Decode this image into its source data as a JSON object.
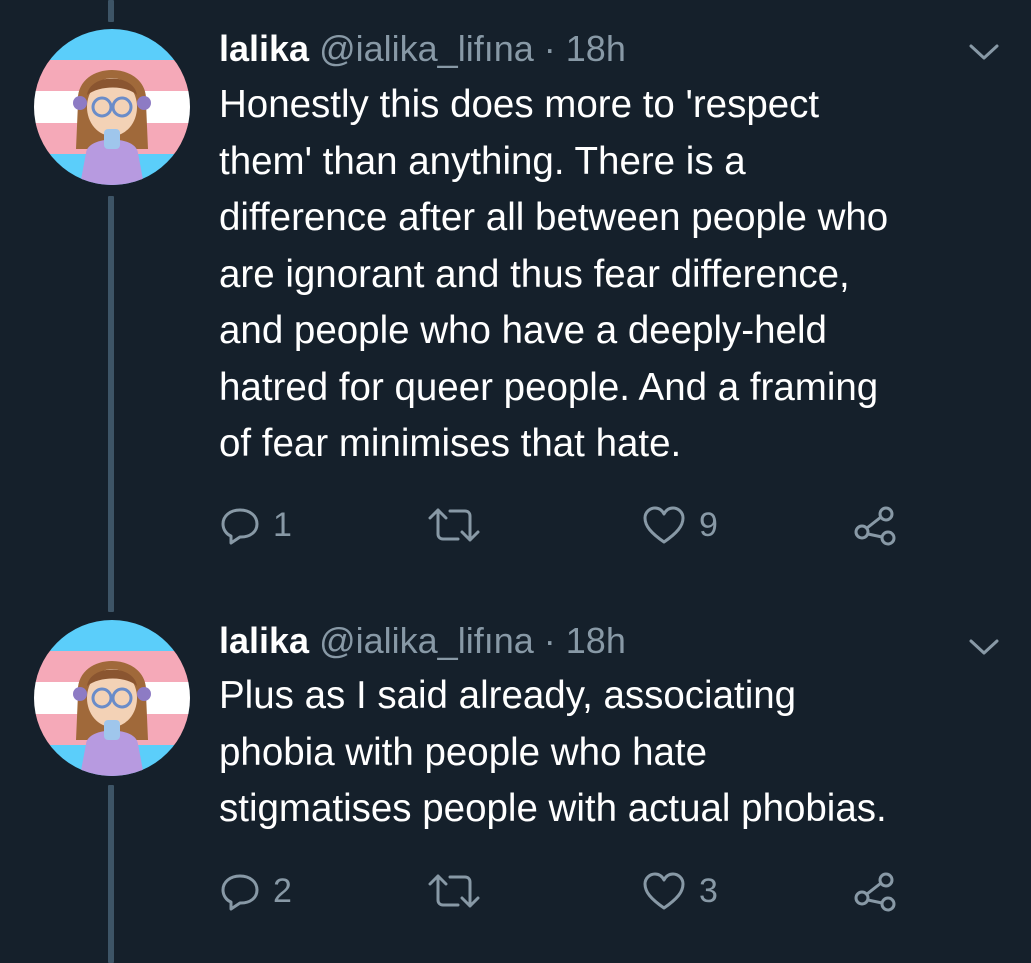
{
  "tweets": [
    {
      "name": "lalika",
      "handle": "@ialika_lifına",
      "separator": "·",
      "time": "18h",
      "text": "Honestly this does more to 'respect\nthem' than anything.  There is a\ndifference after all between people who\nare ignorant and thus fear difference,\nand people who have a deeply-held\nhatred for queer people.  And a framing\nof fear minimises that hate.",
      "replies": "1",
      "likes": "9"
    },
    {
      "name": "lalika",
      "handle": "@ialika_lifına",
      "separator": "·",
      "time": "18h",
      "text": "Plus as I said already, associating\nphobia with people who hate\nstigmatises people with actual phobias.",
      "replies": "2",
      "likes": "3"
    }
  ],
  "colors": {
    "background": "#15202b",
    "secondary_text": "#8899a6",
    "thread_line": "#3d5466"
  }
}
